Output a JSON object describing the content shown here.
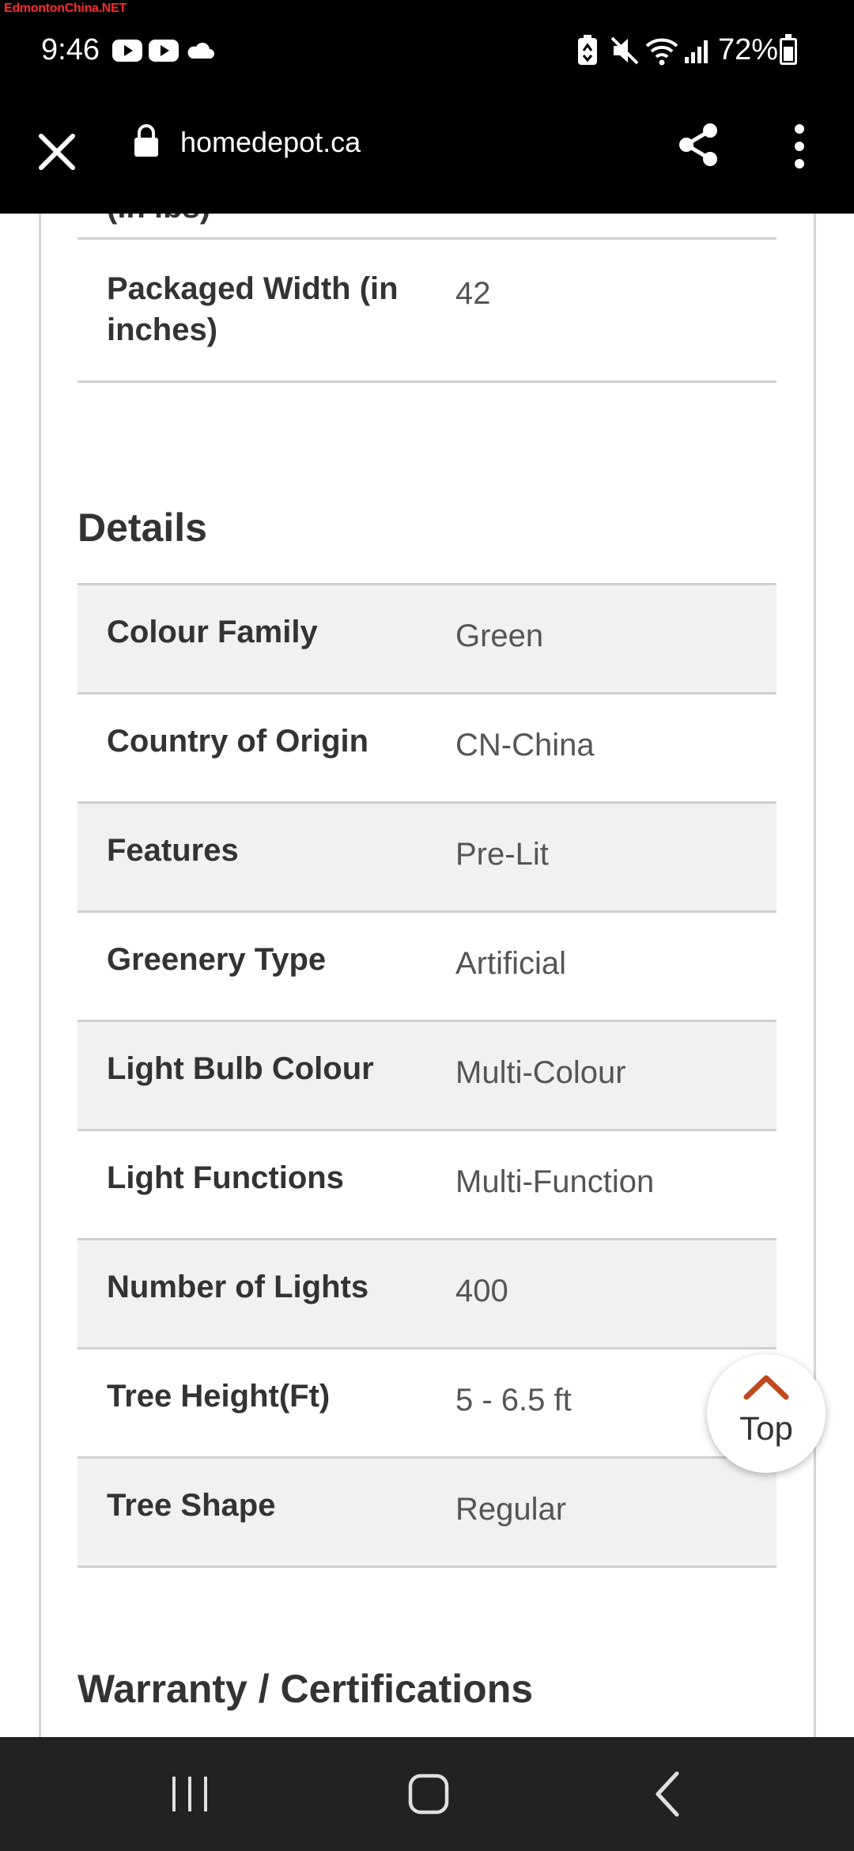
{
  "status_bar": {
    "watermark": "EdmontonChina.NET",
    "time": "9:46",
    "battery": "72%",
    "icons": [
      "youtube-icon",
      "youtube-icon",
      "cloud-icon",
      "recycle-icon",
      "mute-icon",
      "wifi-icon",
      "signal-icon",
      "battery-icon"
    ]
  },
  "browser": {
    "url": "homedepot.ca",
    "icons": [
      "close-icon",
      "lock-icon",
      "share-icon",
      "more-vert-icon"
    ]
  },
  "specs_partial": {
    "cut_label": "(in lbs)",
    "rows": [
      {
        "label_line1": "Packaged Width (in",
        "label_line2": "inches)",
        "value": "42"
      }
    ]
  },
  "details": {
    "title": "Details",
    "rows": [
      {
        "label": "Colour Family",
        "value": "Green"
      },
      {
        "label": "Country of Origin",
        "value": "CN-China"
      },
      {
        "label": "Features",
        "value": "Pre-Lit"
      },
      {
        "label": "Greenery Type",
        "value": "Artificial"
      },
      {
        "label": "Light Bulb Colour",
        "value": "Multi-Colour"
      },
      {
        "label": "Light Functions",
        "value": "Multi-Function"
      },
      {
        "label": "Number of Lights",
        "value": "400"
      },
      {
        "label": "Tree Height(Ft)",
        "value": "5 - 6.5 ft"
      },
      {
        "label": "Tree Shape",
        "value": "Regular"
      }
    ]
  },
  "warranty": {
    "title": "Warranty / Certifications"
  },
  "top_button": {
    "label": "Top"
  },
  "colors": {
    "accent": "#c0491d",
    "row_shade": "#f1f1f1",
    "divider": "#cfcfcf"
  }
}
